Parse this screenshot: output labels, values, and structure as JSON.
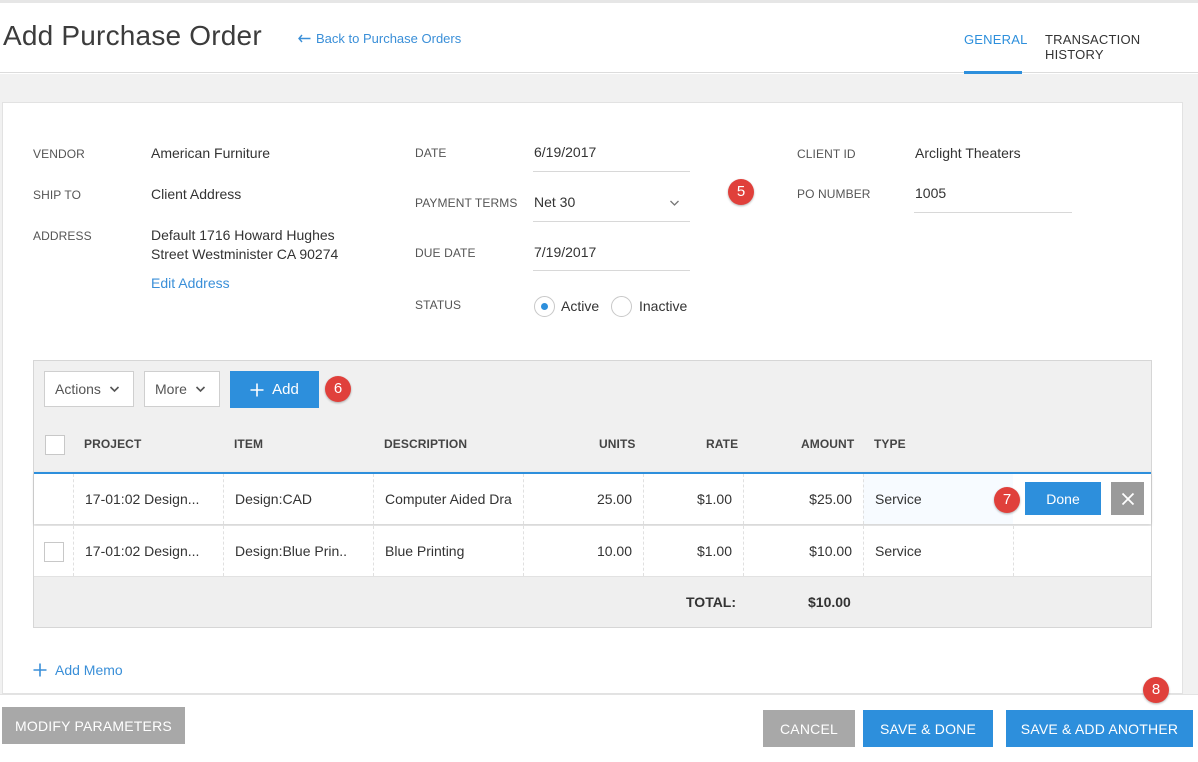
{
  "header": {
    "title": "Add Purchase Order",
    "back_link": "Back to Purchase Orders",
    "tabs": [
      {
        "label": "GENERAL",
        "active": true
      },
      {
        "label": "TRANSACTION HISTORY",
        "active": false
      }
    ]
  },
  "form": {
    "vendor": {
      "label": "VENDOR",
      "value": "American Furniture"
    },
    "ship_to": {
      "label": "SHIP TO",
      "value": "Client Address"
    },
    "address": {
      "label": "ADDRESS",
      "line1": "Default 1716 Howard Hughes",
      "line2": "Street Westminister CA 90274",
      "edit_link": "Edit Address"
    },
    "date": {
      "label": "DATE",
      "value": "6/19/2017"
    },
    "payment_terms": {
      "label": "PAYMENT TERMS",
      "value": "Net 30"
    },
    "due_date": {
      "label": "DUE DATE",
      "value": "7/19/2017"
    },
    "status": {
      "label": "STATUS",
      "options": [
        "Active",
        "Inactive"
      ],
      "selected": "Active"
    },
    "client_id": {
      "label": "CLIENT ID",
      "value": "Arclight Theaters"
    },
    "po_number": {
      "label": "PO NUMBER",
      "value": "1005"
    }
  },
  "badges": {
    "b5": "5",
    "b6": "6",
    "b7": "7",
    "b8": "8"
  },
  "grid": {
    "toolbar": {
      "actions": "Actions",
      "more": "More",
      "add": "Add"
    },
    "columns": [
      "PROJECT",
      "ITEM",
      "DESCRIPTION",
      "UNITS",
      "RATE",
      "AMOUNT",
      "TYPE"
    ],
    "rows": [
      {
        "project": "17-01:02 Design...",
        "item": "Design:CAD",
        "description": "Computer Aided Dra",
        "units": "25.00",
        "rate": "$1.00",
        "amount": "$25.00",
        "type": "Service"
      },
      {
        "project": "17-01:02 Design...",
        "item": "Design:Blue Prin..",
        "description": "Blue Printing",
        "units": "10.00",
        "rate": "$1.00",
        "amount": "$10.00",
        "type": "Service"
      }
    ],
    "done_label": "Done",
    "total_label": "TOTAL:",
    "total_value": "$10.00"
  },
  "add_memo": "Add Memo",
  "footer": {
    "modify": "MODIFY PARAMETERS",
    "cancel": "CANCEL",
    "save_done": "SAVE & DONE",
    "save_add": "SAVE & ADD ANOTHER"
  },
  "colors": {
    "accent": "#2d8fdc",
    "badge": "#e0403b",
    "gray_button": "#a8a8a8"
  }
}
